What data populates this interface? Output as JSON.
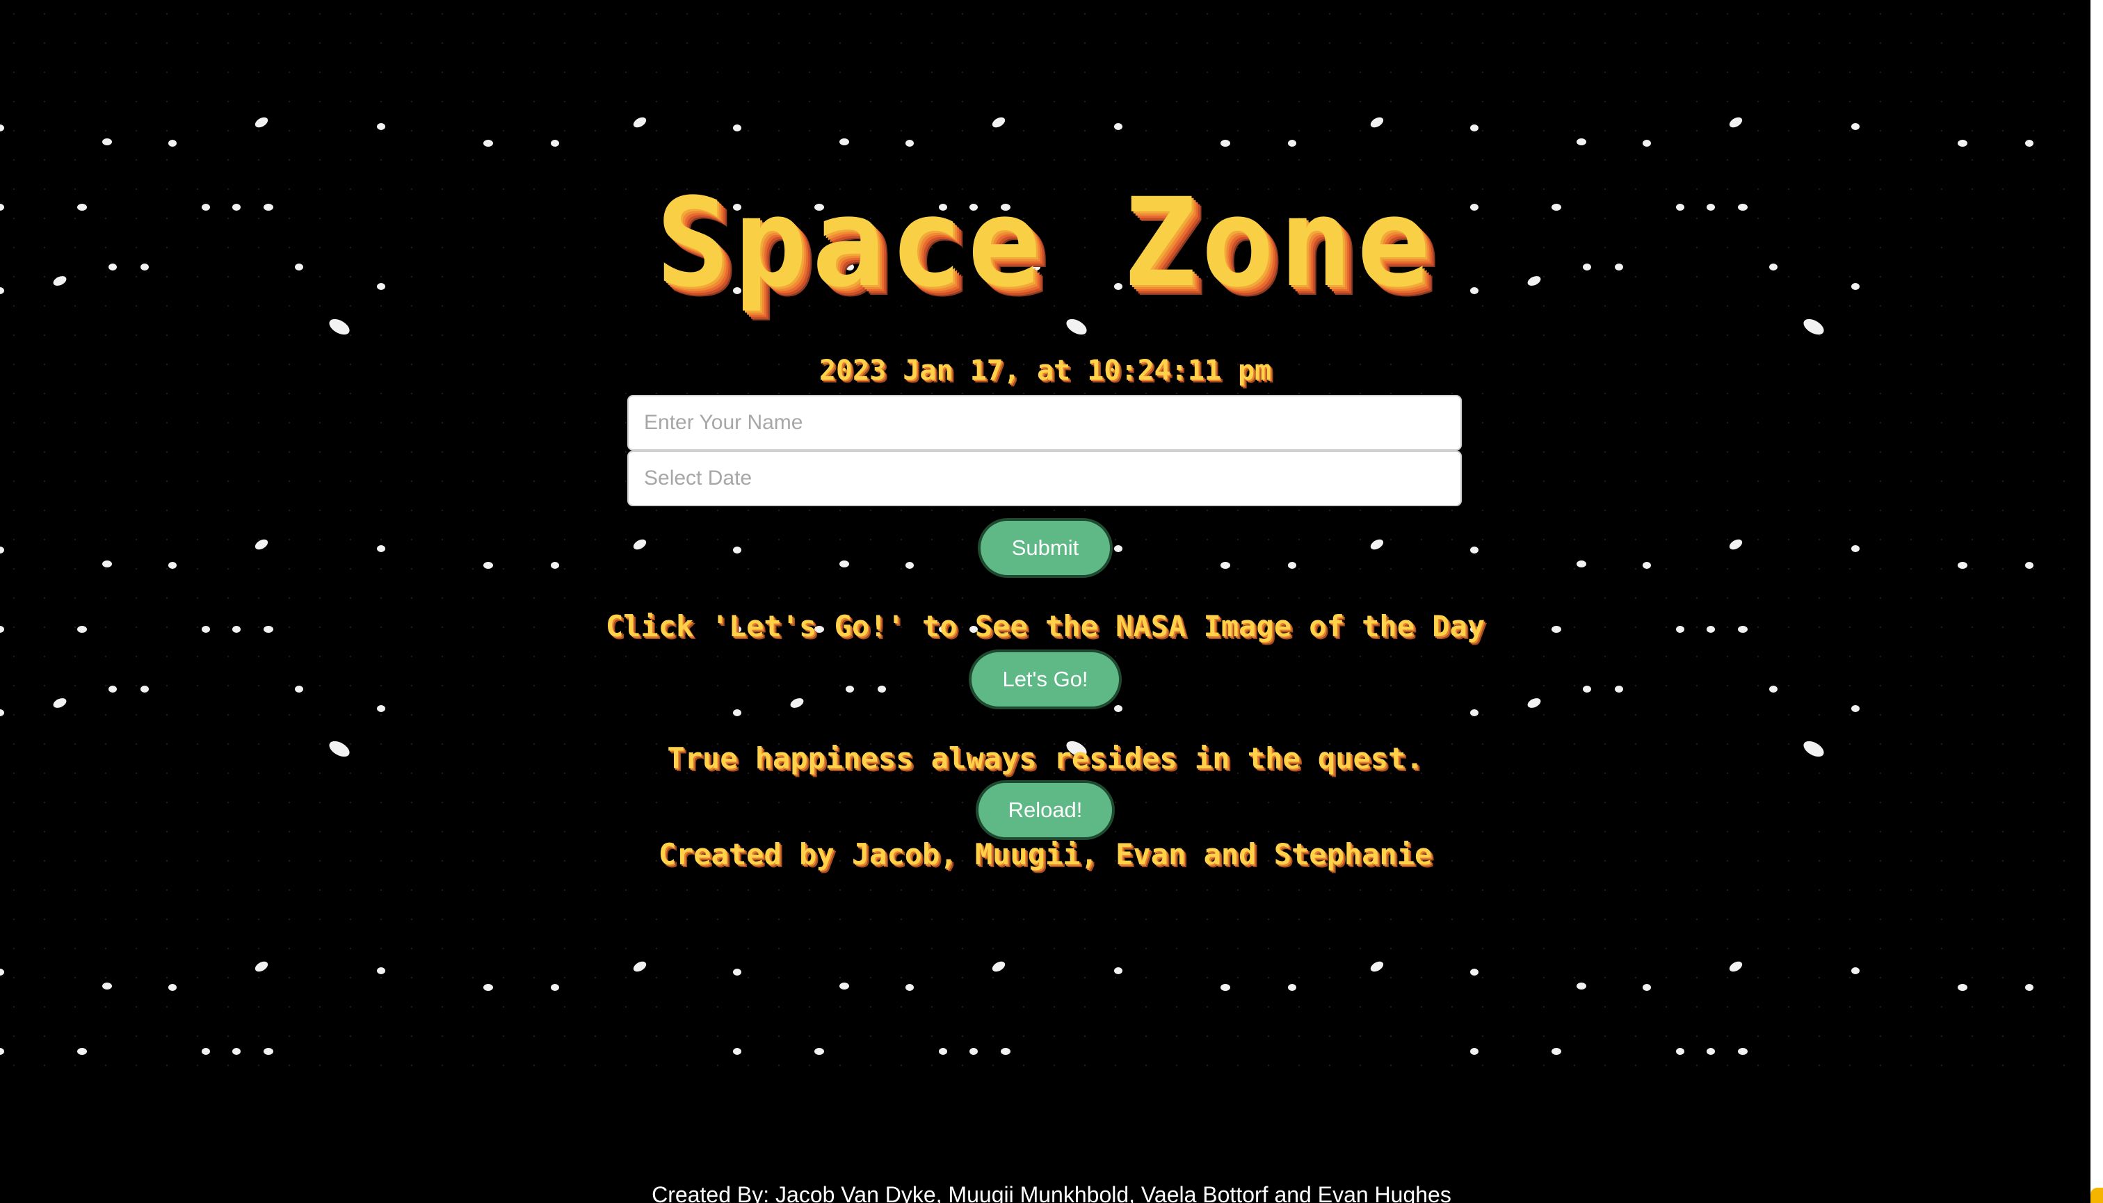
{
  "app": {
    "title": "Space Zone",
    "datetime": "2023 Jan 17, at 10:24:11 pm"
  },
  "form": {
    "name_placeholder": "Enter Your Name",
    "date_placeholder": "Select Date",
    "submit_label": "Submit"
  },
  "nasa": {
    "prompt": "Click 'Let's Go!' to See the NASA Image of the Day",
    "button_label": "Let's Go!"
  },
  "quote": {
    "text": "True happiness always resides in the quest.",
    "reload_label": "Reload!"
  },
  "credits": {
    "inline": "Created by Jacob, Muugii, Evan and Stephanie",
    "footer": "Created By:  Jacob Van Dyke, Muugii Munkhbold, Vaela Bottorf and Evan Hughes"
  },
  "colors": {
    "background": "#000000",
    "title_gold": "#f9cf45",
    "button_green": "#5fb987"
  }
}
